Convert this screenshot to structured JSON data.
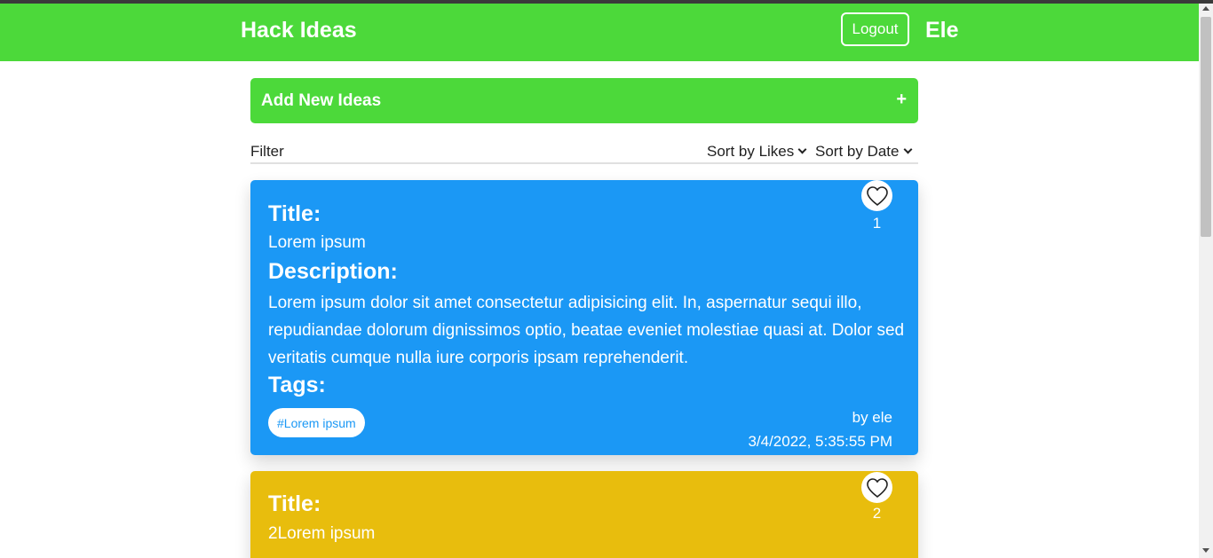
{
  "header": {
    "brand": "Hack Ideas",
    "logout_label": "Logout",
    "username": "Ele"
  },
  "add_ideas": {
    "label": "Add New Ideas",
    "plus": "+"
  },
  "toolbar": {
    "filter_label": "Filter",
    "sort_likes_label": "Sort by Likes",
    "sort_date_label": "Sort by Date"
  },
  "ideas": [
    {
      "title_label": "Title:",
      "title": "Lorem ipsum",
      "description_label": "Description:",
      "description": "Lorem ipsum dolor sit amet consectetur adipisicing elit. In, aspernatur sequi illo, repudiandae dolorum dignissimos optio, beatae eveniet molestiae quasi at. Dolor sed veritatis cumque nulla iure corporis ipsam reprehenderit.",
      "tags_label": "Tags:",
      "tags": [
        "#Lorem ipsum"
      ],
      "likes": "1",
      "author": "by ele",
      "created": "3/4/2022, 5:35:55 PM",
      "color": "#1b98f5",
      "icon": "heart-outline-icon"
    },
    {
      "title_label": "Title:",
      "title": "2Lorem ipsum",
      "likes": "2",
      "color": "#e8bd0d",
      "icon": "heart-outline-icon"
    }
  ],
  "colors": {
    "accent": "#4cd93a",
    "card_blue": "#1b98f5",
    "card_yellow": "#e8bd0d"
  }
}
